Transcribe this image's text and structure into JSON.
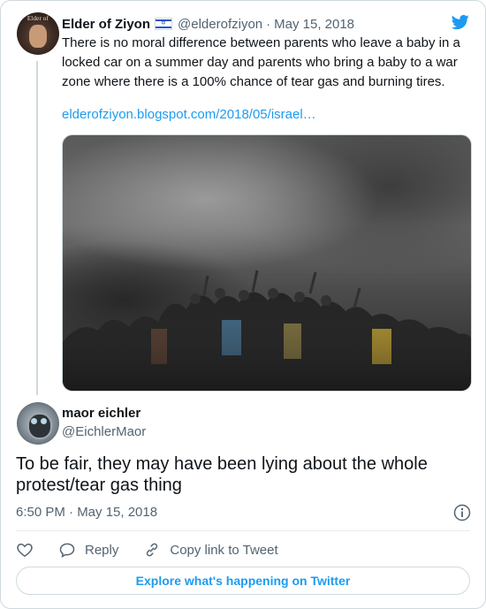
{
  "quoted_tweet": {
    "avatar_text": "Elder of",
    "author_name": "Elder of Ziyon",
    "author_flag": "israel-flag-icon",
    "handle": "@elderofziyon",
    "separator": "·",
    "date": "May 15, 2018",
    "text": "There is no moral difference between parents who leave a baby in a locked car on a summer day and parents who bring a baby to a war zone where there is a 100% chance of tear gas and burning tires.",
    "link": "elderofziyon.blogspot.com/2018/05/israel…"
  },
  "main_tweet": {
    "author_name": "maor eichler",
    "handle": "@EichlerMaor",
    "text": "To be fair, they may have been lying about the whole protest/tear gas thing",
    "timestamp": "6:50 PM · May 15, 2018"
  },
  "actions": {
    "reply_label": "Reply",
    "copy_link_label": "Copy link to Tweet"
  },
  "explore_button": "Explore what's happening on Twitter",
  "colors": {
    "accent": "#1d9bf0",
    "text_primary": "#0f1419",
    "text_secondary": "#536471",
    "border": "#cfd9de"
  },
  "icons": [
    "twitter-bird-icon",
    "info-icon",
    "heart-icon",
    "reply-icon",
    "link-icon",
    "israel-flag-icon"
  ]
}
